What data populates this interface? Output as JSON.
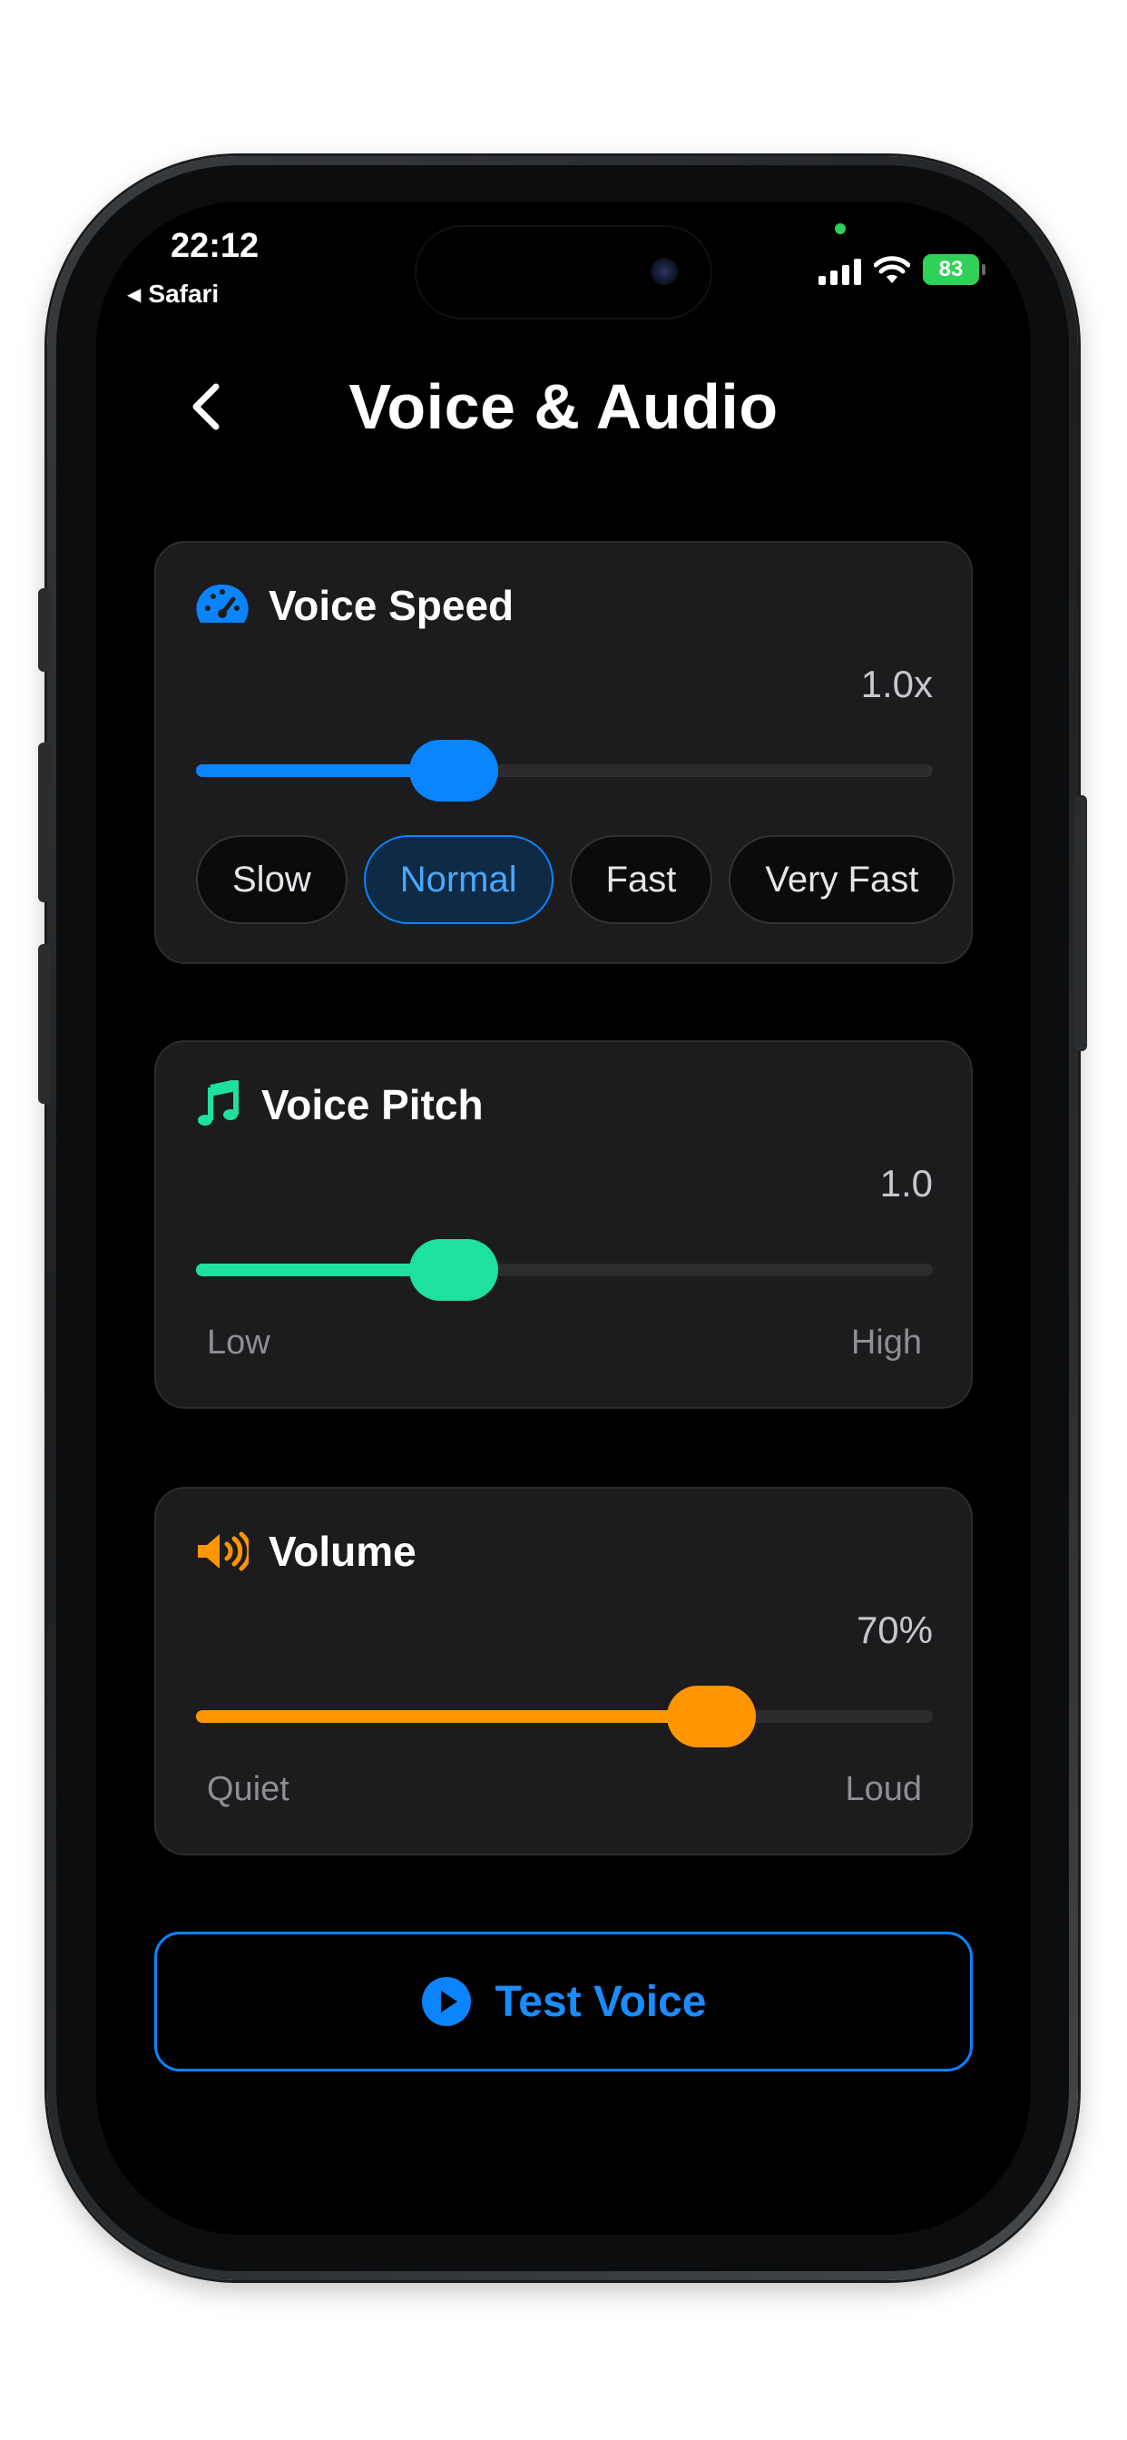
{
  "status_bar": {
    "time": "22:12",
    "back_app": "Safari",
    "battery": "83"
  },
  "header": {
    "title": "Voice & Audio",
    "back_icon": "chevron-left-icon"
  },
  "voice_speed": {
    "label": "Voice Speed",
    "icon": "speedometer-icon",
    "value": "1.0x",
    "level": 0.35,
    "color": "#0a84ff",
    "options": [
      "Slow",
      "Normal",
      "Fast",
      "Very Fast"
    ],
    "selected": "Normal"
  },
  "voice_pitch": {
    "label": "Voice Pitch",
    "icon": "music-note-icon",
    "value": "1.0",
    "level": 0.35,
    "color": "#1ee0a0",
    "min_label": "Low",
    "max_label": "High"
  },
  "volume": {
    "label": "Volume",
    "icon": "speaker-icon",
    "value": "70%",
    "level": 0.7,
    "color": "#ff9500",
    "min_label": "Quiet",
    "max_label": "Loud"
  },
  "test_button": {
    "label": "Test Voice",
    "icon": "play-circle-icon",
    "color": "#0a84ff"
  }
}
